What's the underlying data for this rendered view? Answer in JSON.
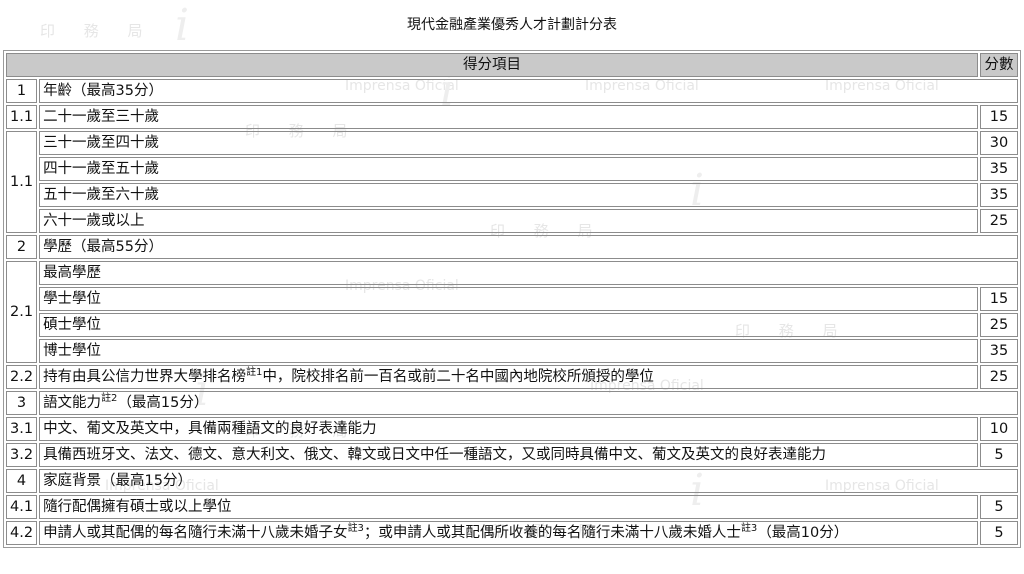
{
  "title": "現代金融產業優秀人才計劃計分表",
  "watermark": {
    "seal_text": "印 務 局",
    "text": "Imprensa Oficial",
    "logo": "i"
  },
  "table": {
    "header_item": "得分項目",
    "header_score": "分數",
    "sections": {
      "s1": {
        "num": "1",
        "label": "年齡（最高35分）",
        "r1_num": "1.1",
        "r1_label": "二十一歲至三十歲",
        "r1_score": "15",
        "r2_num": "1.1",
        "r2_label": "三十一歲至四十歲",
        "r2_score": "30",
        "r3_label": "四十一歲至五十歲",
        "r3_score": "35",
        "r4_label": "五十一歲至六十歲",
        "r4_score": "35",
        "r5_label": "六十一歲或以上",
        "r5_score": "25"
      },
      "s2": {
        "num": "2",
        "label": "學歷（最高55分）",
        "r1_num": "2.1",
        "r1_label": "最高學歷",
        "r2_label": "學士學位",
        "r2_score": "15",
        "r3_label": "碩士學位",
        "r3_score": "25",
        "r4_label": "博士學位",
        "r4_score": "35",
        "r5_num": "2.2",
        "r5_label_a": "持有由具公信力世界大學排名榜",
        "r5_note": "註1",
        "r5_label_b": "中，院校排名前一百名或前二十名中國內地院校所頒授的學位",
        "r5_score": "25"
      },
      "s3": {
        "num": "3",
        "label_a": "語文能力",
        "label_note": "註2",
        "label_b": "（最高15分）",
        "r1_num": "3.1",
        "r1_label": "中文、葡文及英文中，具備兩種語文的良好表達能力",
        "r1_score": "10",
        "r2_num": "3.2",
        "r2_label": "具備西班牙文、法文、德文、意大利文、俄文、韓文或日文中任一種語文，又或同時具備中文、葡文及英文的良好表達能力",
        "r2_score": "5"
      },
      "s4": {
        "num": "4",
        "label": "家庭背景（最高15分）",
        "r1_num": "4.1",
        "r1_label": "隨行配偶擁有碩士或以上學位",
        "r1_score": "5",
        "r2_num": "4.2",
        "r2_label_a": "申請人或其配偶的每名隨行未滿十八歲未婚子女",
        "r2_note_a": "註3",
        "r2_label_b": "；或申請人或其配偶所收養的每名隨行未滿十八歲未婚人士",
        "r2_note_b": "註3",
        "r2_label_c": "（最高10分）",
        "r2_score": "5"
      }
    }
  }
}
